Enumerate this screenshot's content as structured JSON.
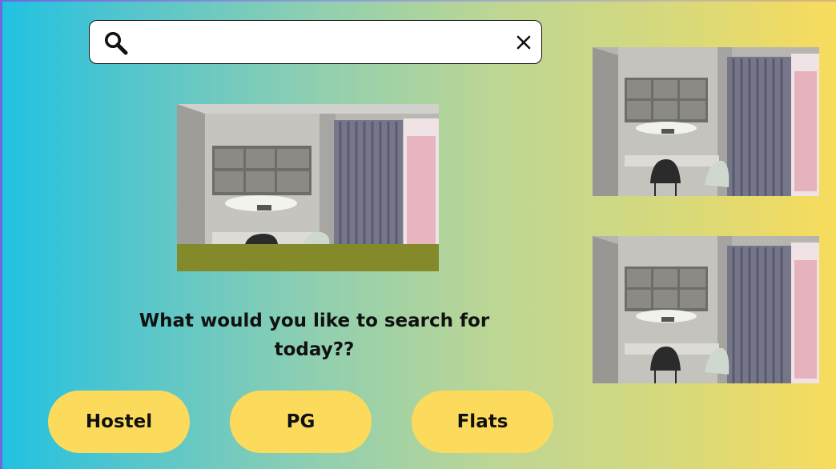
{
  "search": {
    "value": "",
    "placeholder": ""
  },
  "prompt": "What would you like to search for today??",
  "categories": [
    {
      "label": "Hostel"
    },
    {
      "label": "PG"
    },
    {
      "label": "Flats"
    }
  ],
  "icons": {
    "search": "search-icon",
    "close": "close-icon"
  },
  "photos": [
    {
      "subject": "room interior with desk, shelves and curtains"
    },
    {
      "subject": "room interior with desk, shelves and curtains"
    },
    {
      "subject": "room interior with desk, shelves and curtains"
    }
  ],
  "colors": {
    "button_fill": "#fcdb5c",
    "gradient_start": "#1fc2e2",
    "gradient_end": "#f8dc5c"
  }
}
